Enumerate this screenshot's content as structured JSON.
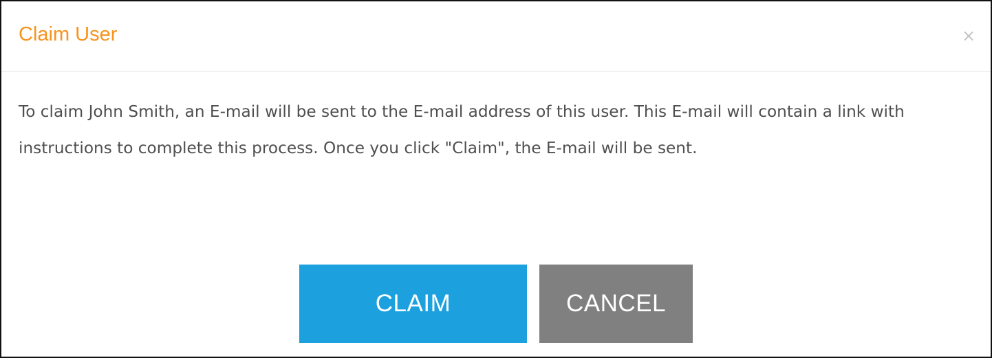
{
  "dialog": {
    "title": "Claim User",
    "close_symbol": "×",
    "close_icon": "close-icon",
    "message": "To claim John Smith, an E-mail will be sent to the E-mail address of this user. This E-mail will contain a link with instructions to complete this process. Once you click \"Claim\", the E-mail will be sent.",
    "claim_label": "CLAIM",
    "cancel_label": "CANCEL"
  },
  "colors": {
    "title": "#f7941d",
    "claim_button": "#1da1de",
    "cancel_button": "#808080",
    "body_text": "#4f4f4f",
    "close_icon": "#c4c4c4"
  }
}
